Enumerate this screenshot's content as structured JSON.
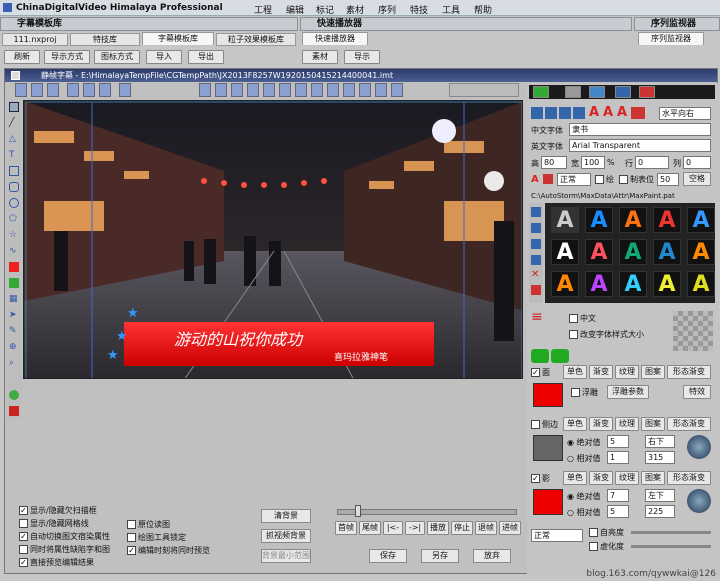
{
  "app": {
    "title": "ChinaDigitalVideo Himalaya Professional"
  },
  "menu": [
    "工程",
    "编辑",
    "标记",
    "素材",
    "序列",
    "特技",
    "工具",
    "帮助"
  ],
  "panels": {
    "subtitle_lib": {
      "title": "字幕模板库",
      "tabs": [
        "111.nxproj",
        "特技库",
        "字幕模板库",
        "粒子效果模板库"
      ],
      "buttons": [
        "刷新",
        "导示方式",
        "图标方式",
        "导入",
        "导出"
      ]
    },
    "fast_player": {
      "title": "快速播放器",
      "tab": "快速播放器",
      "buttons": [
        "素材",
        "导示"
      ]
    },
    "seq_monitor": {
      "title": "序列监视器",
      "tab": "序列监视器"
    }
  },
  "editor": {
    "title": "静帧字幕 - E:\\HimalayaTempFile\\CGTempPath\\JX2013F8257W1920150415214400041.imt",
    "subtitle_main": "游动的山祝你成功",
    "subtitle_sub": "喜玛拉雅神笔",
    "options": [
      {
        "label": "显示/隐藏欠扫描框",
        "checked": true
      },
      {
        "label": "显示/隐藏网格线",
        "checked": false
      },
      {
        "label": "自动切换图文宿染属性",
        "checked": true
      },
      {
        "label": "同时将属性缺陷字和图",
        "checked": false
      },
      {
        "label": "直接预览编辑结果",
        "checked": true
      }
    ],
    "options2": [
      {
        "label": "原位读图",
        "checked": false
      },
      {
        "label": "绘图工具锁定",
        "checked": false
      },
      {
        "label": "编辑时刻将同时预览",
        "checked": true
      }
    ],
    "bg_buttons": [
      "清背景",
      "抓视频背景",
      "背景最小范围"
    ],
    "transport": [
      "首帧",
      "尾帧",
      "|<-",
      "->|",
      "播放",
      "停止",
      "退帧",
      "进帧"
    ],
    "actions": [
      "保存",
      "另存",
      "放弃"
    ]
  },
  "props": {
    "align_label": "水平向右",
    "cn_font_label": "中文字体",
    "cn_font": "隶书",
    "en_font_label": "英文字体",
    "en_font": "Arial Transparent",
    "size_row": {
      "h_label": "高",
      "h": "80",
      "w_label": "宽",
      "w": "100",
      "pct": "%",
      "row_label": "行",
      "row": "0",
      "col_label": "列",
      "col": "0"
    },
    "style_row": {
      "mode": "正常",
      "chk1": "绘",
      "chk2": "制表位",
      "tab": "50",
      "space": "空格"
    },
    "path": "C:\\AutoStorm\\MaxData\\Attr\\MaxPaint.pat",
    "cn_chk": "中文",
    "lib_chk": "改变字体样式大小",
    "face": {
      "label": "面",
      "tabs": [
        "单色",
        "渐变",
        "纹理",
        "图案",
        "形态渐变"
      ],
      "blur": "浮雕",
      "blur_param": "浮雕参数",
      "effect": "特效",
      "color": "#ee1111"
    },
    "edge": {
      "label": "侧边",
      "tabs": [
        "单色",
        "渐变",
        "纹理",
        "图案",
        "形态渐变"
      ],
      "abs": "绝对值",
      "abs_val": "5",
      "dir": "右下",
      "rel": "相对值",
      "rel_val": "1",
      "deg": "315",
      "color": "#666666"
    },
    "shadow": {
      "label": "影",
      "tabs": [
        "单色",
        "渐变",
        "纹理",
        "图案",
        "形态渐变"
      ],
      "abs": "绝对值",
      "abs_val": "7",
      "dir": "左下",
      "rel": "相对值",
      "rel_val": "5",
      "deg": "225",
      "color": "#ee1111"
    },
    "blend": {
      "mode": "正常",
      "bright": "自亮度",
      "virtual": "虚化度"
    }
  },
  "watermark": "blog.163.com/qywwkai@126"
}
